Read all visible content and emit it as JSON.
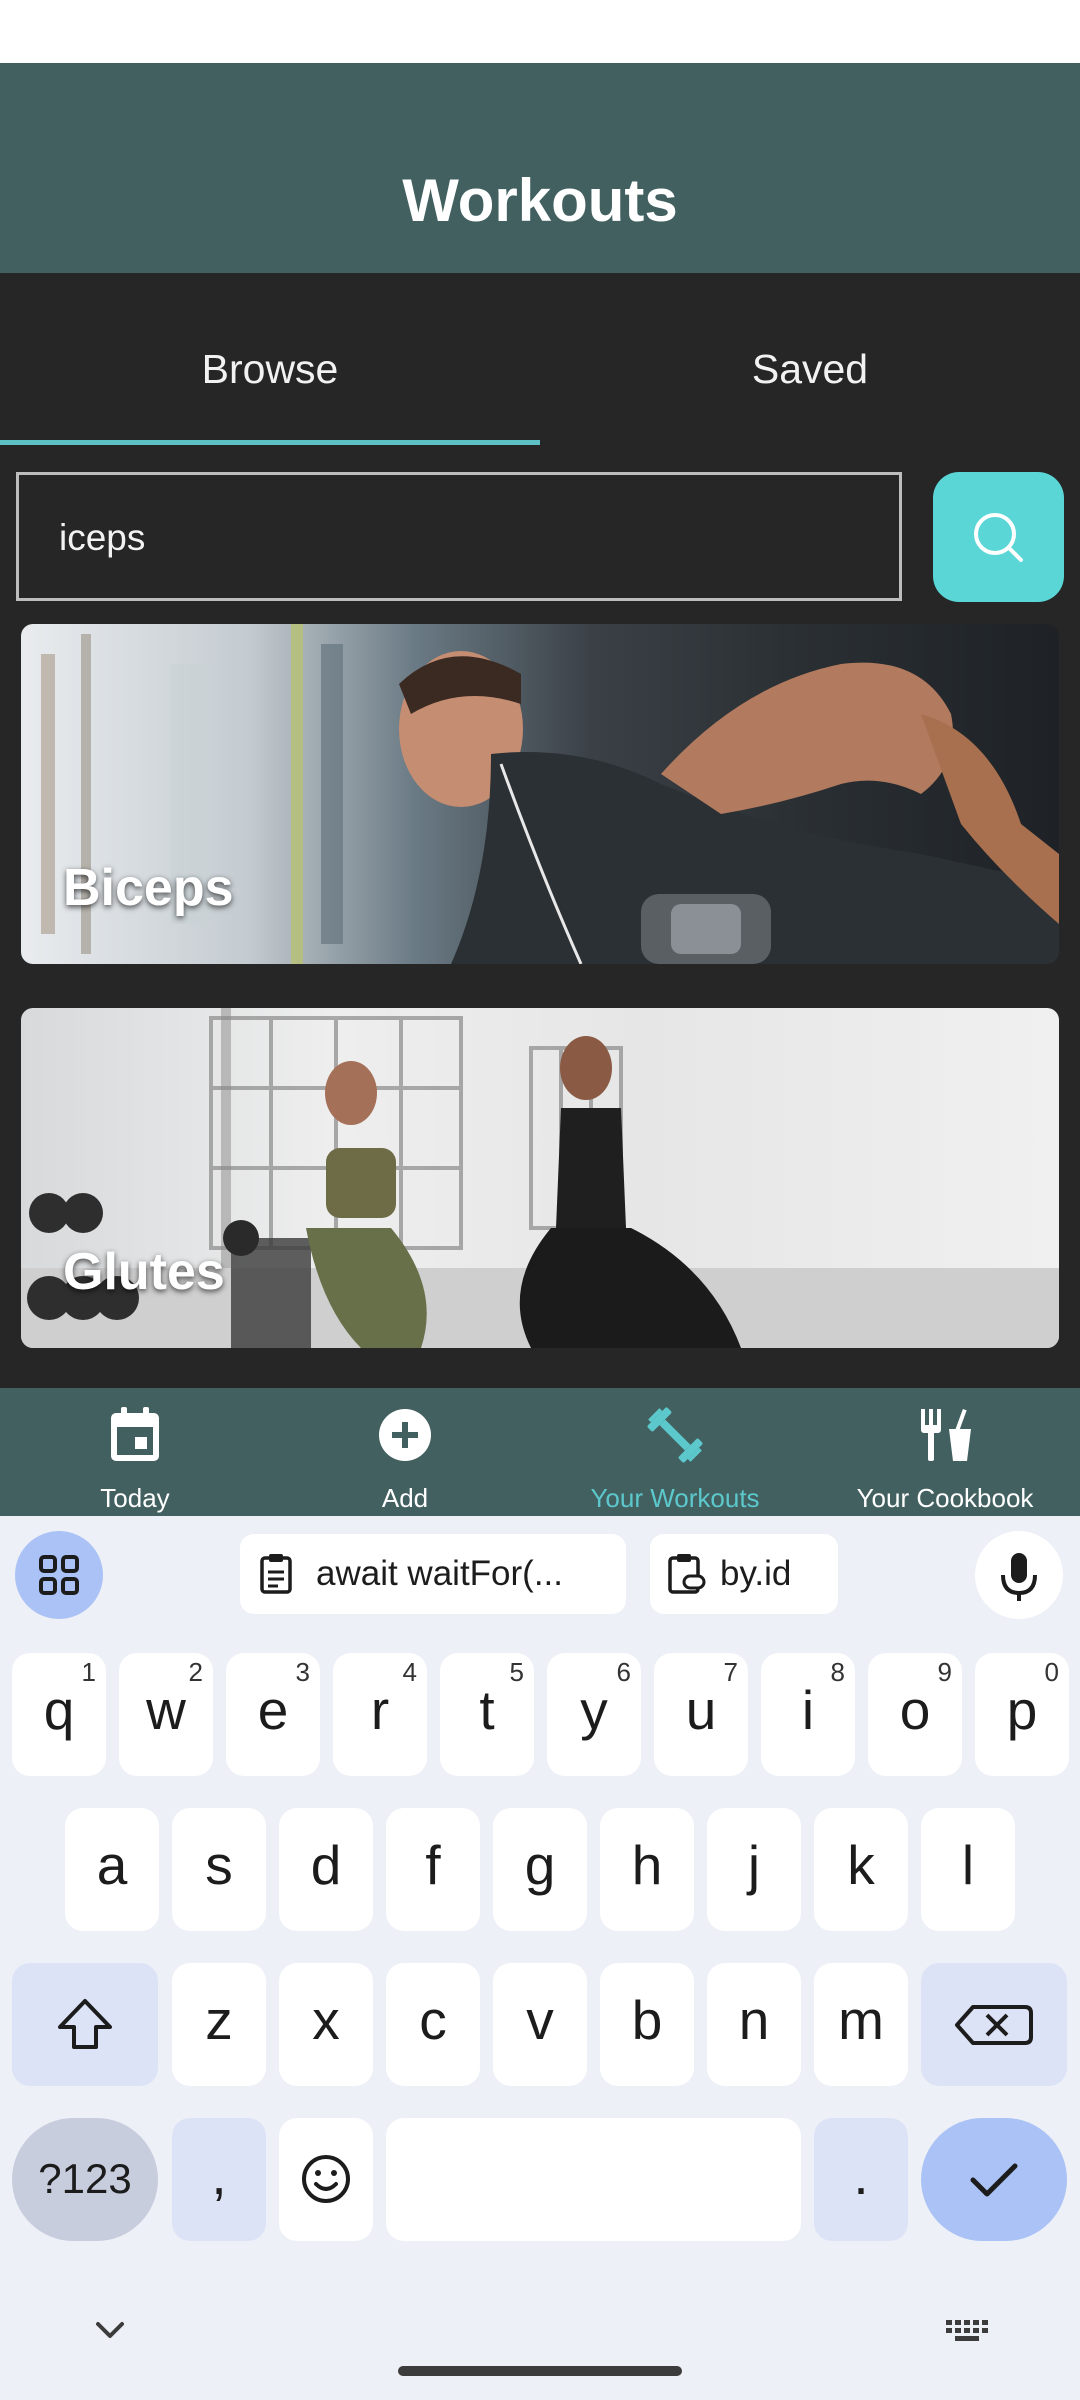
{
  "header": {
    "title": "Workouts"
  },
  "tabs": [
    {
      "label": "Browse",
      "selected": true
    },
    {
      "label": "Saved",
      "selected": false
    }
  ],
  "search": {
    "value": "iceps",
    "button_icon": "search-icon"
  },
  "cards": [
    {
      "label": "Biceps"
    },
    {
      "label": "Glutes"
    }
  ],
  "bottom_nav": [
    {
      "label": "Today",
      "icon": "calendar-icon",
      "active": false
    },
    {
      "label": "Add",
      "icon": "add-circle-icon",
      "active": false
    },
    {
      "label": "Your Workouts",
      "icon": "dumbbell-icon",
      "active": true
    },
    {
      "label": "Your Cookbook",
      "icon": "utensils-icon",
      "active": false
    }
  ],
  "keyboard": {
    "suggestions": [
      "await waitFor(...",
      "by.id"
    ],
    "row1": [
      {
        "ch": "q",
        "num": "1"
      },
      {
        "ch": "w",
        "num": "2"
      },
      {
        "ch": "e",
        "num": "3"
      },
      {
        "ch": "r",
        "num": "4"
      },
      {
        "ch": "t",
        "num": "5"
      },
      {
        "ch": "y",
        "num": "6"
      },
      {
        "ch": "u",
        "num": "7"
      },
      {
        "ch": "i",
        "num": "8"
      },
      {
        "ch": "o",
        "num": "9"
      },
      {
        "ch": "p",
        "num": "0"
      }
    ],
    "row2": [
      "a",
      "s",
      "d",
      "f",
      "g",
      "h",
      "j",
      "k",
      "l"
    ],
    "row3": [
      "z",
      "x",
      "c",
      "v",
      "b",
      "n",
      "m"
    ],
    "symbols_label": "?123",
    "comma": ",",
    "period": "."
  },
  "colors": {
    "header": "#426060",
    "background": "#262626",
    "accent": "#5cc0c4",
    "search_button": "#5bd6d6"
  }
}
